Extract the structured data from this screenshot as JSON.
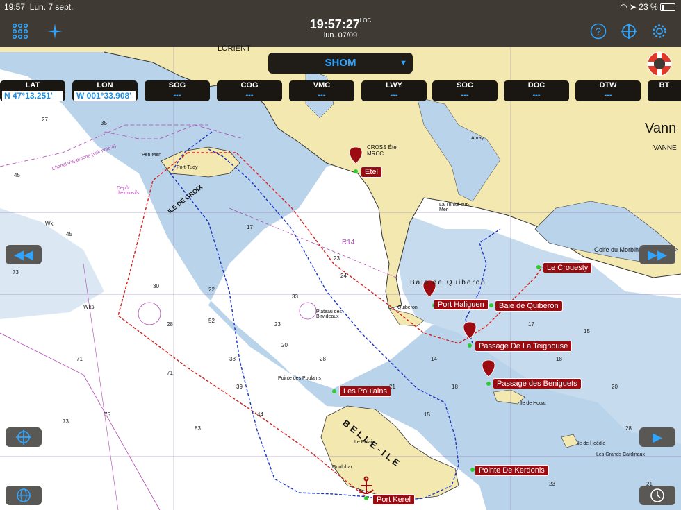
{
  "status": {
    "time": "19:57",
    "date": "Lun. 7 sept.",
    "battery": "23 %"
  },
  "topbar": {
    "clock": "19:57:27",
    "clock_suffix": "LOC",
    "date": "lun. 07/09"
  },
  "chart_source": {
    "label": "SHOM"
  },
  "databoxes": [
    {
      "label": "LAT",
      "value": "N  47°13.251'"
    },
    {
      "label": "LON",
      "value": "W 001°33.908'"
    },
    {
      "label": "SOG",
      "value": "---"
    },
    {
      "label": "COG",
      "value": "---"
    },
    {
      "label": "VMC",
      "value": "---"
    },
    {
      "label": "LWY",
      "value": "---"
    },
    {
      "label": "SOC",
      "value": "---"
    },
    {
      "label": "DOC",
      "value": "---"
    },
    {
      "label": "DTW",
      "value": "---"
    },
    {
      "label": "BT",
      "value": ""
    }
  ],
  "waypoints": [
    {
      "name": "Etel"
    },
    {
      "name": "Le Crouesty"
    },
    {
      "name": "Port Haliguen"
    },
    {
      "name": "Baie de Quiberon"
    },
    {
      "name": "Passage De La Teignouse"
    },
    {
      "name": "Passage des Beniguets"
    },
    {
      "name": "Les Poulains"
    },
    {
      "name": "Pointe De Kerdonis"
    },
    {
      "name": "Port Kerel"
    }
  ],
  "map_labels": {
    "lorient": "LORIENT",
    "vannes": "Vann",
    "vannes2": "VANNE",
    "ile_de_groix": "ILE DE GROIX",
    "belle_ile": "BELLE-ILE",
    "baie": "Baie de Quiberon",
    "golfe": "Golfe du Morbihan",
    "cross": "CROSS Étel MRCC",
    "port_tudy": "Port-Tudy",
    "pen_men": "Pen Men",
    "plateau": "Plateau des Birvideaux",
    "houat": "Ile de Houat",
    "hoedic": "Ile de Hoëdic",
    "cardinaux": "Les Grands Cardinaux",
    "le_palais": "Le Palais",
    "goulphar": "Goulphar",
    "quiberon": "Quiberon",
    "auray": "Auray",
    "trinite": "La Trinité-sur-Mer",
    "pointe_poulains": "Pointe des Poulains",
    "r14": "R14",
    "depot": "Dépôt d'explosifs",
    "chenal": "Chenal d'approche (voir note 4)"
  },
  "colors": {
    "land": "#f3e8b0",
    "shallow": "#b9d3ea",
    "deep": "#ffffff",
    "route_red": "#d81e1e",
    "route_blue": "#1a33c4",
    "wp": "#9a0c12",
    "accent": "#2fa5ff"
  }
}
